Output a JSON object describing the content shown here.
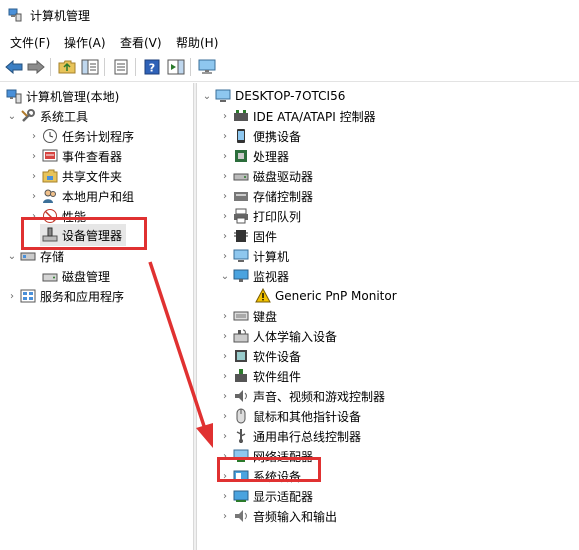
{
  "window": {
    "title": "计算机管理"
  },
  "menubar": [
    {
      "label": "文件(F)"
    },
    {
      "label": "操作(A)"
    },
    {
      "label": "查看(V)"
    },
    {
      "label": "帮助(H)"
    }
  ],
  "toolbar": [
    {
      "icon": "back-arrow-icon"
    },
    {
      "icon": "forward-arrow-icon"
    },
    {
      "icon": "up-folder-icon"
    },
    {
      "icon": "show-hide-tree-icon"
    },
    {
      "icon": "properties-icon"
    },
    {
      "icon": "help-icon"
    },
    {
      "icon": "action-pane-icon"
    },
    {
      "icon": "monitor-icon"
    }
  ],
  "left_tree": {
    "root": "计算机管理(本地)",
    "system_tools": "系统工具",
    "task_scheduler": "任务计划程序",
    "event_viewer": "事件查看器",
    "shared_folders": "共享文件夹",
    "local_users": "本地用户和组",
    "performance": "性能",
    "device_manager": "设备管理器",
    "storage": "存储",
    "disk_management": "磁盘管理",
    "services_apps": "服务和应用程序"
  },
  "right_tree": {
    "computer_name": "DESKTOP-7OTCI56",
    "items": [
      {
        "label": "IDE ATA/ATAPI 控制器",
        "icon": "ide-controller-icon"
      },
      {
        "label": "便携设备",
        "icon": "portable-device-icon"
      },
      {
        "label": "处理器",
        "icon": "processor-icon"
      },
      {
        "label": "磁盘驱动器",
        "icon": "disk-drive-icon"
      },
      {
        "label": "存储控制器",
        "icon": "storage-controller-icon"
      },
      {
        "label": "打印队列",
        "icon": "printer-icon"
      },
      {
        "label": "固件",
        "icon": "firmware-icon"
      },
      {
        "label": "计算机",
        "icon": "computer-icon"
      },
      {
        "label": "监视器",
        "icon": "monitor-icon"
      },
      {
        "label": "Generic PnP Monitor",
        "icon": "warning-icon"
      },
      {
        "label": "键盘",
        "icon": "keyboard-icon"
      },
      {
        "label": "人体学输入设备",
        "icon": "hid-icon"
      },
      {
        "label": "软件设备",
        "icon": "software-device-icon"
      },
      {
        "label": "软件组件",
        "icon": "software-component-icon"
      },
      {
        "label": "声音、视频和游戏控制器",
        "icon": "sound-icon"
      },
      {
        "label": "鼠标和其他指针设备",
        "icon": "mouse-icon"
      },
      {
        "label": "通用串行总线控制器",
        "icon": "usb-icon"
      },
      {
        "label": "网络适配器",
        "icon": "network-adapter-icon"
      },
      {
        "label": "系统设备",
        "icon": "system-device-icon"
      },
      {
        "label": "显示适配器",
        "icon": "display-adapter-icon"
      },
      {
        "label": "音频输入和输出",
        "icon": "audio-io-icon"
      }
    ]
  },
  "colors": {
    "highlight": "#e03131",
    "tree_chevron": "#6b6b6b"
  }
}
